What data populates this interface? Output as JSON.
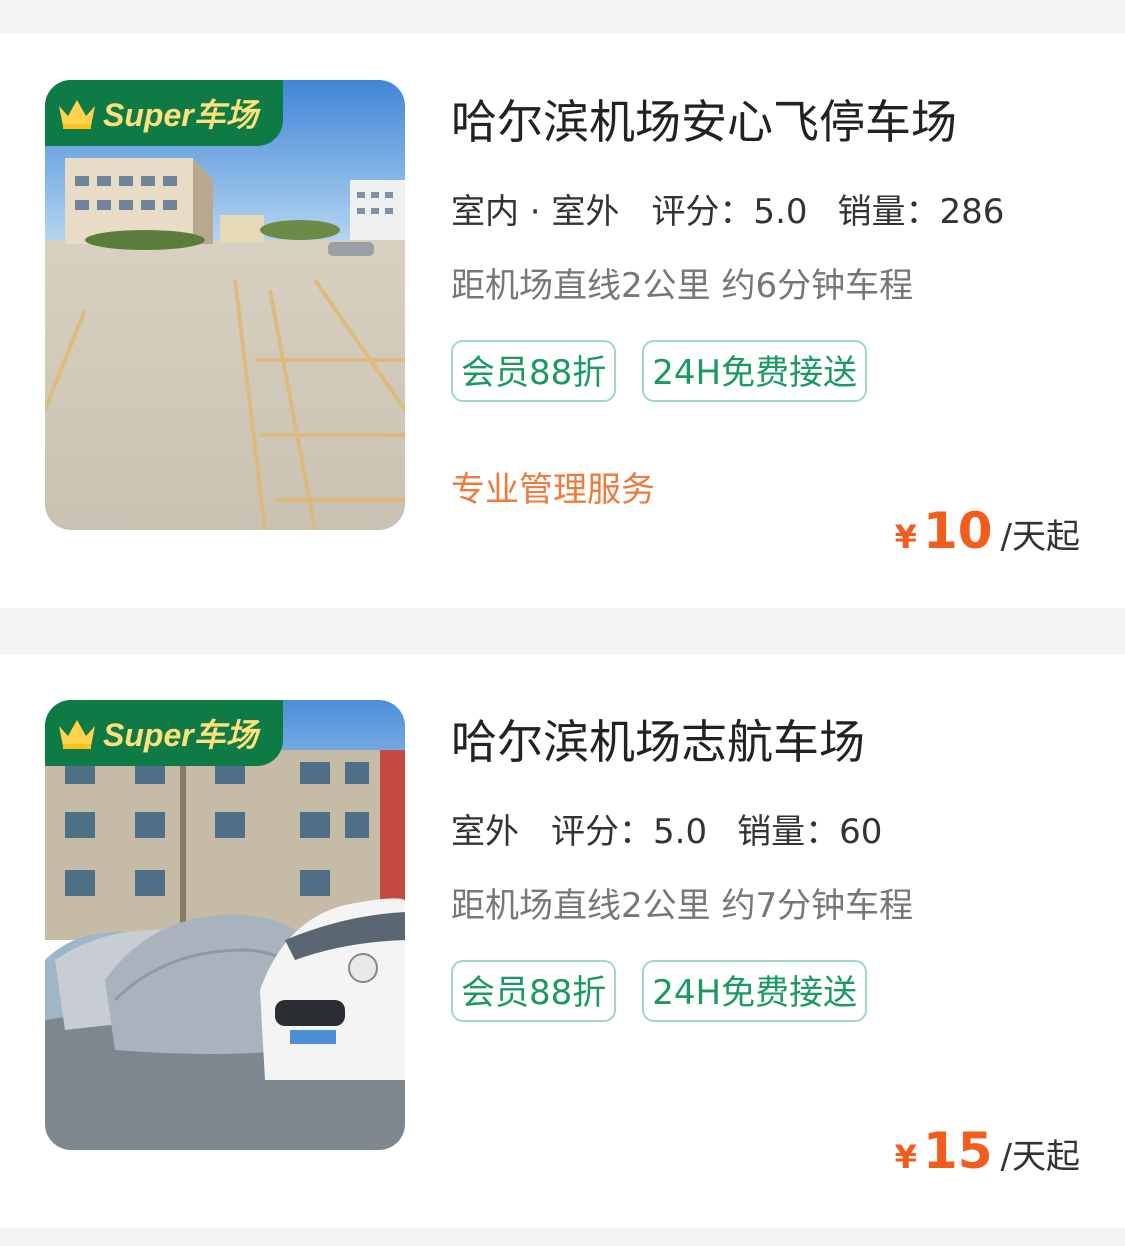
{
  "lots": [
    {
      "badge": "Super车场",
      "title": "哈尔滨机场安心飞停车场",
      "type": "室内 · 室外",
      "rating": "评分：5.0",
      "sales": "销量：286",
      "distance": "距机场直线2公里 约6分钟车程",
      "tags": [
        "会员88折",
        "24H免费接送"
      ],
      "service": "专业管理服务",
      "price": {
        "symbol": "¥",
        "amount": "10",
        "unit": "/天起"
      }
    },
    {
      "badge": "Super车场",
      "title": "哈尔滨机场志航车场",
      "type": "室外",
      "rating": "评分：5.0",
      "sales": "销量：60",
      "distance": "距机场直线2公里 约7分钟车程",
      "tags": [
        "会员88折",
        "24H免费接送"
      ],
      "service": "",
      "price": {
        "symbol": "¥",
        "amount": "15",
        "unit": "/天起"
      }
    }
  ],
  "colors": {
    "badge_bg": "#0e7a45",
    "badge_text": "#ffe07a",
    "tag": "#1a9a62",
    "service": "#f07a3e",
    "price": "#f25c1c"
  }
}
